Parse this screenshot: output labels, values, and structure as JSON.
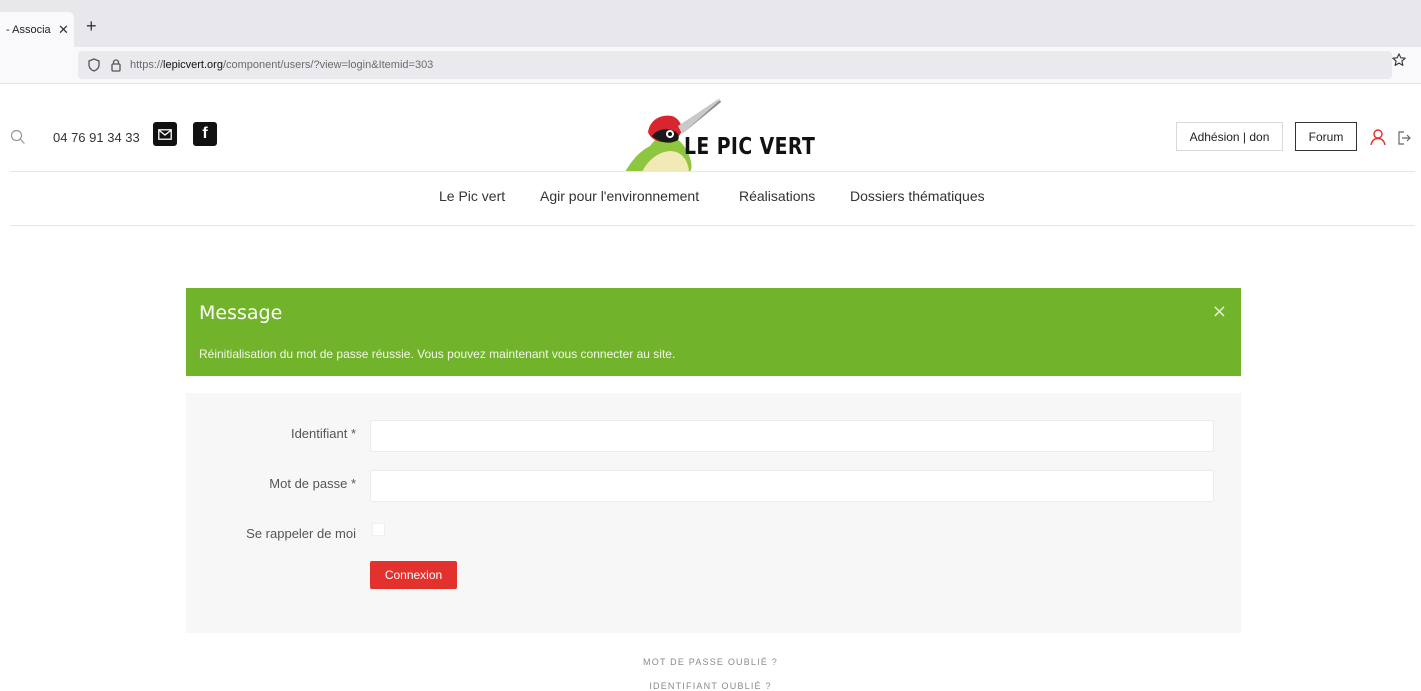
{
  "browser": {
    "tab_title": "- Associa",
    "tab_close": "✕",
    "new_tab": "+",
    "url_scheme": "https://",
    "url_host": "lepicvert.org",
    "url_rest": "/component/users/?view=login&Itemid=303"
  },
  "header": {
    "phone": "04 76 91 34 33",
    "facebook_glyph": "f",
    "logo_text": "LE PIC VERT",
    "adhesion_label": "Adhésion | don",
    "forum_label": "Forum"
  },
  "nav": {
    "items": [
      "Le Pic vert",
      "Agir pour l'environnement",
      "Réalisations",
      "Dossiers thématiques"
    ]
  },
  "alert": {
    "title": "Message",
    "text": "Réinitialisation du mot de passe réussie. Vous pouvez maintenant vous connecter au site.",
    "close": "×",
    "color": "#72b32c"
  },
  "form": {
    "username_label": "Identifiant *",
    "username_value": "",
    "password_label": "Mot de passe *",
    "password_value": "",
    "remember_label": "Se rappeler de moi",
    "remember_checked": false,
    "submit_label": "Connexion",
    "submit_color": "#e3312d"
  },
  "links": {
    "forgot_password": "MOT DE PASSE OUBLIÉ ?",
    "forgot_username": "IDENTIFIANT OUBLIÉ ?"
  },
  "icons": [
    "shield-icon",
    "lock-icon",
    "star-icon",
    "search-icon",
    "mail-icon",
    "facebook-icon",
    "woodpecker-logo",
    "user-icon",
    "logout-icon",
    "close-icon"
  ]
}
